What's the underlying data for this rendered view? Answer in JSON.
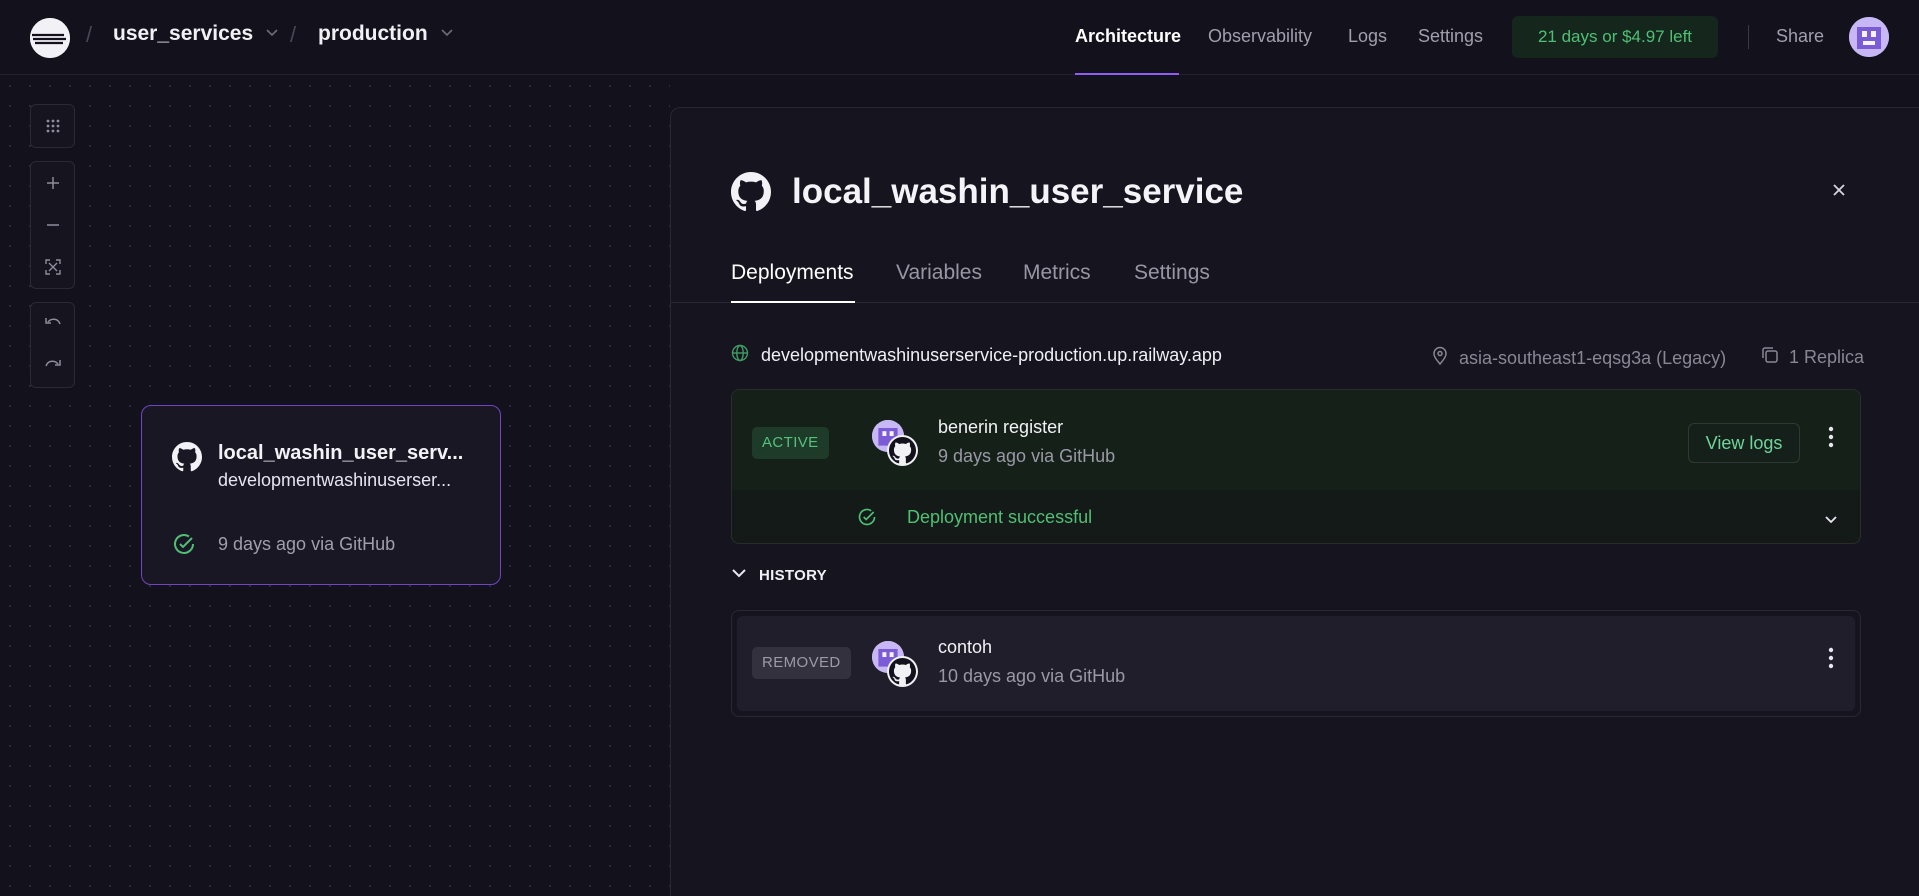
{
  "header": {
    "project": "user_services",
    "environment": "production",
    "nav": [
      "Architecture",
      "Observability",
      "Logs",
      "Settings"
    ],
    "active_nav": "Architecture",
    "trial": "21 days or $4.97 left",
    "share": "Share"
  },
  "canvas": {
    "service_card": {
      "title": "local_washin_user_serv...",
      "subtitle": "developmentwashinuserser...",
      "status_time": "9 days ago via GitHub"
    }
  },
  "panel": {
    "title": "local_washin_user_service",
    "tabs": [
      "Deployments",
      "Variables",
      "Metrics",
      "Settings"
    ],
    "active_tab": "Deployments",
    "domain": "developmentwashinuserservice-production.up.railway.app",
    "region": "asia-southeast1-eqsg3a (Legacy)",
    "replicas": "1 Replica",
    "active_deployment": {
      "badge": "ACTIVE",
      "commit": "benerin register",
      "meta": "9 days ago via GitHub",
      "view_logs": "View logs",
      "status": "Deployment successful"
    },
    "history_label": "HISTORY",
    "history": [
      {
        "badge": "REMOVED",
        "commit": "contoh",
        "meta": "10 days ago via GitHub"
      }
    ]
  },
  "colors": {
    "accent": "#8b5cf6",
    "success": "#4fbf75",
    "background": "#13111c"
  }
}
